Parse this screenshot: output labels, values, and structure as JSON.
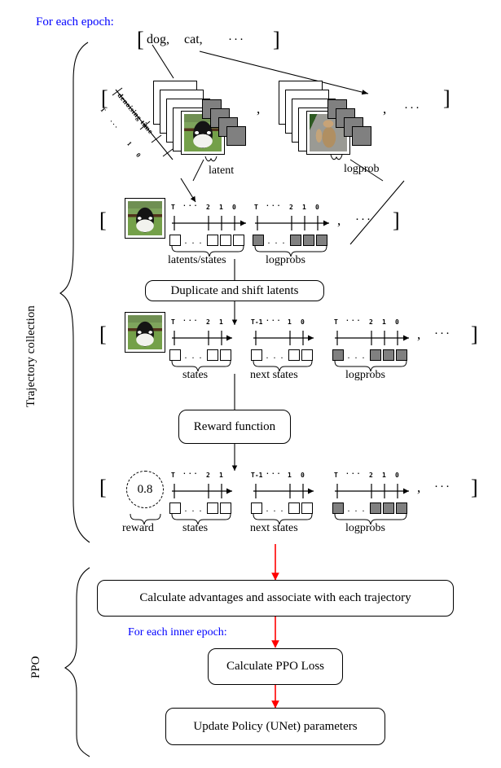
{
  "diagram": {
    "title_labels": {
      "for_each_epoch": "For each epoch:",
      "for_each_inner_epoch": "For each inner epoch:"
    },
    "phase_labels": {
      "trajectory_collection": "Trajectory collection",
      "ppo": "PPO"
    },
    "colors": {
      "loop_label": "#0000ff",
      "flow_arrow": "#ff0000",
      "stroke": "#000000",
      "logprob_fill": "#808080",
      "latent_fill": "#ffffff",
      "background": "#ffffff"
    },
    "prompt_row": {
      "open_bracket": "[",
      "items": [
        "dog,",
        "cat,"
      ],
      "ellipsis": "···",
      "close_bracket": "]"
    },
    "stack_row": {
      "open_bracket": "[",
      "comma": ",",
      "ellipsis": "···",
      "close_bracket": "]",
      "axis_label": "denoising time",
      "axis_ticks": [
        "T",
        "· · ·",
        "1",
        "0"
      ],
      "callouts": {
        "latent": "latent",
        "logprob": "logprob"
      },
      "stacks": [
        {
          "name": "dog-stack",
          "image": "dog",
          "white_cards": 4,
          "gray_cards": 4
        },
        {
          "name": "cat-stack",
          "image": "cat",
          "white_cards": 4,
          "gray_cards": 4
        }
      ]
    },
    "trajectory_row": {
      "open_bracket": "[",
      "comma": ",",
      "ellipsis": "···",
      "close_bracket": "]",
      "image": "dog",
      "tracks": [
        {
          "name": "latents-states",
          "label": "latents/states",
          "ticks": [
            "T",
            "···",
            "2",
            "1",
            "0"
          ],
          "boxes": 4,
          "box_fill": "#ffffff",
          "box_dots": "· · ·"
        },
        {
          "name": "logprobs",
          "label": "logprobs",
          "ticks": [
            "T",
            "···",
            "2",
            "1",
            "0"
          ],
          "boxes": 4,
          "box_fill": "#808080",
          "box_dots": "· · ·"
        }
      ]
    },
    "shifted_row": {
      "open_bracket": "[",
      "comma": ",",
      "ellipsis": "···",
      "close_bracket": "]",
      "image": "dog",
      "tracks": [
        {
          "name": "states",
          "label": "states",
          "ticks": [
            "T",
            "···",
            "2",
            "1"
          ],
          "boxes": 3,
          "box_fill": "#ffffff",
          "box_dots": "· · ·"
        },
        {
          "name": "next-states",
          "label": "next states",
          "ticks": [
            "T-1",
            "···",
            "1",
            "0"
          ],
          "boxes": 3,
          "box_fill": "#ffffff",
          "box_dots": "· · ·"
        },
        {
          "name": "logprobs",
          "label": "logprobs",
          "ticks": [
            "T",
            "···",
            "2",
            "1",
            "0"
          ],
          "boxes": 4,
          "box_fill": "#808080",
          "box_dots": "· · ·"
        }
      ]
    },
    "reward_row": {
      "open_bracket": "[",
      "comma": ",",
      "ellipsis": "···",
      "close_bracket": "]",
      "reward_value": "0.8",
      "reward_label": "reward",
      "tracks": [
        {
          "name": "states",
          "label": "states",
          "ticks": [
            "T",
            "···",
            "2",
            "1"
          ],
          "boxes": 3,
          "box_fill": "#ffffff",
          "box_dots": "· · ·"
        },
        {
          "name": "next-states",
          "label": "next states",
          "ticks": [
            "T-1",
            "···",
            "1",
            "0"
          ],
          "boxes": 3,
          "box_fill": "#ffffff",
          "box_dots": "· · ·"
        },
        {
          "name": "logprobs",
          "label": "logprobs",
          "ticks": [
            "T",
            "···",
            "2",
            "1",
            "0"
          ],
          "boxes": 4,
          "box_fill": "#808080",
          "box_dots": "· · ·"
        }
      ]
    },
    "process_boxes": [
      {
        "name": "duplicate-shift-latents",
        "label": "Duplicate and shift latents"
      },
      {
        "name": "reward-function",
        "label": "Reward function"
      },
      {
        "name": "calculate-advantages",
        "label": "Calculate advantages and associate with each trajectory"
      },
      {
        "name": "calculate-ppo-loss",
        "label": "Calculate PPO Loss"
      },
      {
        "name": "update-policy",
        "label": "Update Policy (UNet) parameters"
      }
    ]
  }
}
